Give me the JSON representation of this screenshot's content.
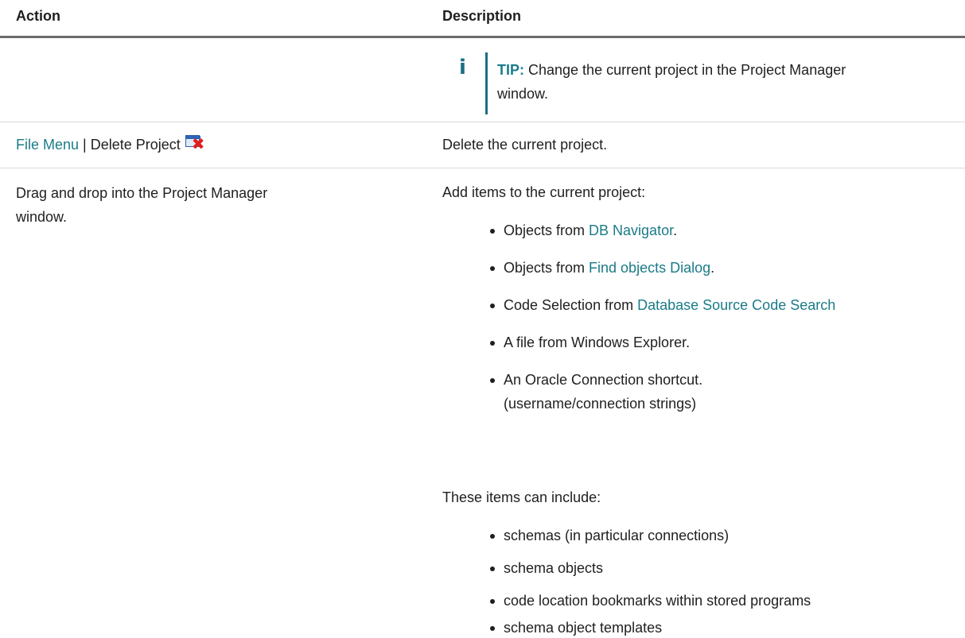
{
  "table": {
    "headers": {
      "action": "Action",
      "description": "Description"
    },
    "tip": {
      "icon": "info-icon",
      "label": "TIP:",
      "text": " Change the current project in the Project Manager window."
    },
    "row_delete": {
      "action_link": "File Menu",
      "action_text": " | Delete Project",
      "action_icon": "delete-project-icon",
      "description": "Delete the current project."
    },
    "row_drag": {
      "action_line1": "Drag and drop into the Project Manager",
      "action_line2": "window.",
      "intro": "Add items to the current project:",
      "items": [
        {
          "prefix": "Objects from ",
          "link": "DB Navigator",
          "suffix": "."
        },
        {
          "prefix": "Objects from ",
          "link": "Find objects Dialog",
          "suffix": "."
        },
        {
          "prefix": "Code Selection from ",
          "link": "Database Source Code Search",
          "suffix": ""
        },
        {
          "text": "A file from Windows Explorer."
        },
        {
          "line1": "An Oracle Connection shortcut.",
          "line2": "(username/connection strings)"
        }
      ],
      "include_intro": "These items can include:",
      "include_items": [
        "schemas (in particular connections)",
        "schema objects",
        "code location bookmarks within stored programs",
        "schema object templates"
      ]
    }
  },
  "colors": {
    "link": "#1b7b87",
    "tip_accent": "#1c6e83",
    "header_rule": "#6b6b6b"
  }
}
